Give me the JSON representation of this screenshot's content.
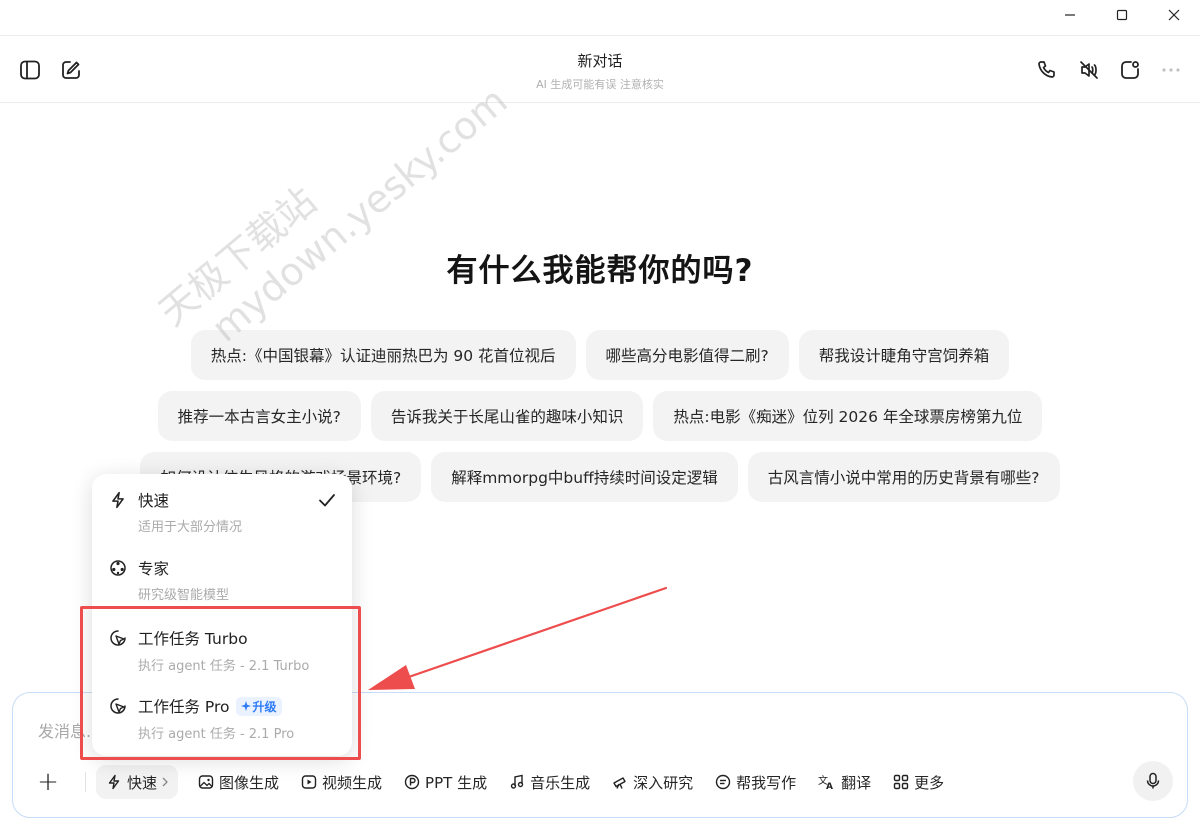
{
  "header": {
    "title": "新对话",
    "subtitle": "AI 生成可能有误 注意核实"
  },
  "hero": {
    "heading": "有什么我能帮你的吗?"
  },
  "suggestions": {
    "row1": [
      "热点:《中国银幕》认证迪丽热巴为 90 花首位视后",
      "哪些高分电影值得二刷?",
      "帮我设计睫角守宫饲养箱"
    ],
    "row2": [
      "推荐一本古言女主小说?",
      "告诉我关于长尾山雀的趣味小知识",
      "热点:电影《痴迷》位列 2026 年全球票房榜第九位"
    ],
    "row3": [
      "如何设计仿生风格的游戏场景环境?",
      "解释mmorpg中buff持续时间设定逻辑",
      "古风言情小说中常用的历史背景有哪些?"
    ]
  },
  "watermark": {
    "line1": "天极下载站",
    "line2": "mydown.yesky.com"
  },
  "dropdown": {
    "options": [
      {
        "title": "快速",
        "desc": "适用于大部分情况",
        "icon": "lightning-icon",
        "selected": true
      },
      {
        "title": "专家",
        "desc": "研究级智能模型",
        "icon": "expert-icon",
        "selected": false
      },
      {
        "title": "工作任务 Turbo",
        "desc": "执行 agent 任务 - 2.1 Turbo",
        "icon": "agent-icon",
        "selected": false
      },
      {
        "title": "工作任务 Pro",
        "desc": "执行 agent 任务 - 2.1 Pro",
        "icon": "agent-icon",
        "selected": false,
        "badge": "升级"
      }
    ]
  },
  "input": {
    "placeholder": "发消息..."
  },
  "toolbar": {
    "mode": "快速",
    "tools": [
      "图像生成",
      "视频生成",
      "PPT 生成",
      "音乐生成",
      "深入研究",
      "帮我写作",
      "翻译",
      "更多"
    ]
  },
  "colors": {
    "accent": "#2f7cf6",
    "highlight": "#ee4d4d",
    "input_border": "#c7dcf9",
    "chip_bg": "#f3f3f3"
  }
}
